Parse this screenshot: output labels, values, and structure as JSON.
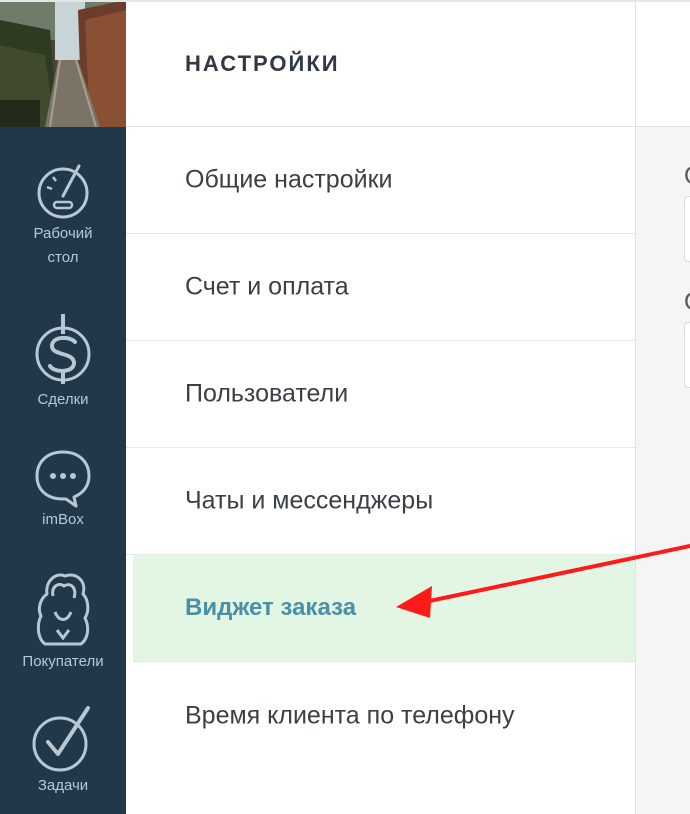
{
  "sidebar": {
    "photo_alt": "",
    "items": [
      {
        "label": "Рабочий\nстол",
        "icon": "dashboard-gauge-icon"
      },
      {
        "label": "Сделки",
        "icon": "dollar-icon"
      },
      {
        "label": "imBox",
        "icon": "chat-bubble-icon"
      },
      {
        "label": "Покупатели",
        "icon": "customers-icon"
      },
      {
        "label": "Задачи",
        "icon": "check-circle-icon"
      }
    ]
  },
  "settings": {
    "title": "НАСТРОЙКИ",
    "menu": [
      {
        "label": "Общие настройки"
      },
      {
        "label": "Счет и оплата"
      },
      {
        "label": "Пользователи"
      },
      {
        "label": "Чаты и мессенджеры"
      },
      {
        "label": "Виджет заказа",
        "active": true
      },
      {
        "label": "Время клиента по телефону"
      }
    ]
  },
  "content": {
    "label_1": "О",
    "label_2": "О"
  },
  "colors": {
    "sidebar_bg": "#21374a",
    "active_bg": "#e3f6e3",
    "active_text": "#4b8fa9",
    "annotation_arrow": "#ff1a1a"
  }
}
